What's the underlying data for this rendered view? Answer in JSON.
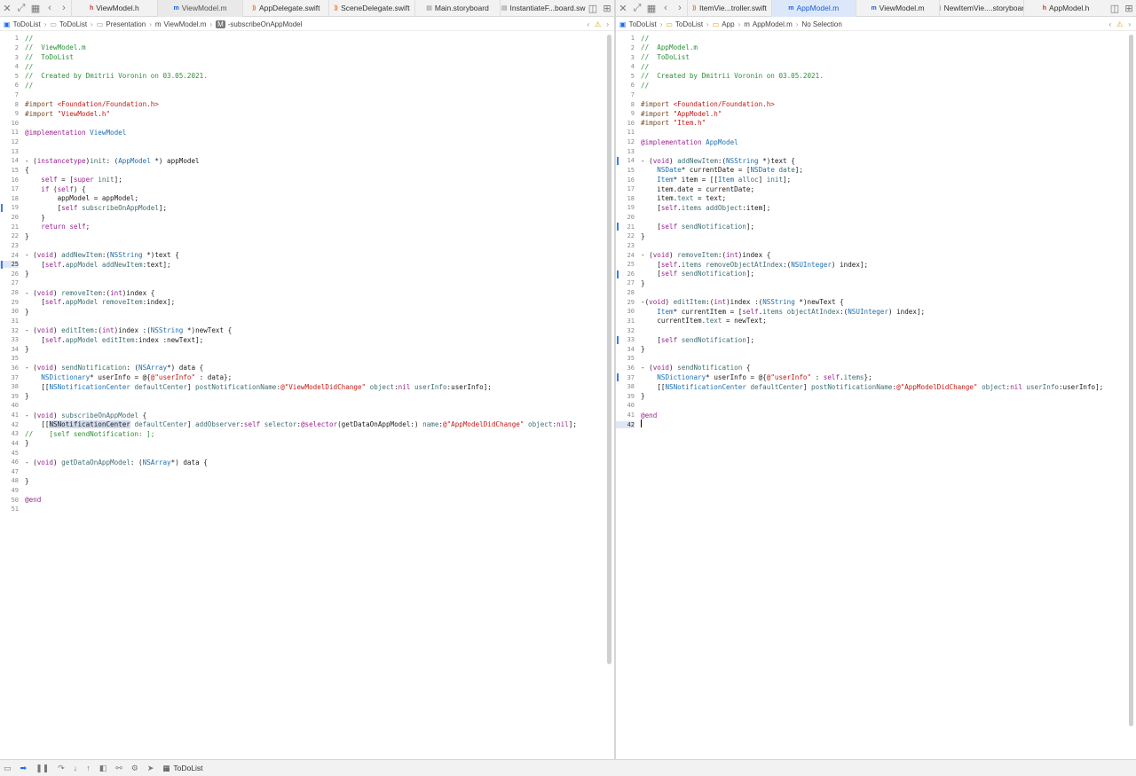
{
  "left": {
    "tabs": [
      {
        "icon": "h",
        "label": "ViewModel.h"
      },
      {
        "icon": "m",
        "label": "ViewModel.m"
      },
      {
        "icon": "swift",
        "label": "AppDelegate.swift"
      },
      {
        "icon": "swift",
        "label": "SceneDelegate.swift"
      },
      {
        "icon": "storyboard",
        "label": "Main.storyboard"
      },
      {
        "icon": "storyboard",
        "label": "InstantiateF...board.sw"
      }
    ],
    "breadcrumb": [
      "ToDoList",
      "ToDoList",
      "Presentation",
      "ViewModel.m",
      "-subscribeOnAppModel"
    ],
    "current_line": 25
  },
  "right": {
    "tabs": [
      {
        "icon": "swift",
        "label": "ItemVie...troller.swift"
      },
      {
        "icon": "m",
        "label": "AppModel.m"
      },
      {
        "icon": "m",
        "label": "ViewModel.m"
      },
      {
        "icon": "storyboard",
        "label": "NewItemVie....storyboard"
      },
      {
        "icon": "h",
        "label": "AppModel.h"
      }
    ],
    "breadcrumb": [
      "ToDoList",
      "ToDoList",
      "App",
      "AppModel.m",
      "No Selection"
    ],
    "current_line": 42
  },
  "bottom": {
    "scheme": "ToDoList"
  },
  "colors": {
    "accent": "#1b6cf2",
    "comment": "#2f8f3a",
    "keyword": "#9b2393",
    "string": "#c41a16",
    "type": "#1c6fb0"
  },
  "code_left": [
    [
      [
        "cm",
        "//"
      ]
    ],
    [
      [
        "cm",
        "//  ViewModel.m"
      ]
    ],
    [
      [
        "cm",
        "//  ToDoList"
      ]
    ],
    [
      [
        "cm",
        "//"
      ]
    ],
    [
      [
        "cm",
        "//  Created by Dmitrii Voronin on 03.05.2021."
      ]
    ],
    [
      [
        "cm",
        "//"
      ]
    ],
    [],
    [
      [
        "pp",
        "#import "
      ],
      [
        "st",
        "<Foundation/Foundation.h>"
      ]
    ],
    [
      [
        "pp",
        "#import "
      ],
      [
        "st",
        "\"ViewModel.h\""
      ]
    ],
    [],
    [
      [
        "kw",
        "@implementation "
      ],
      [
        "ty",
        "ViewModel"
      ]
    ],
    [],
    [],
    [
      [
        "",
        "- ("
      ],
      [
        "kw",
        "instancetype"
      ],
      [
        "",
        ")"
      ],
      [
        "mt",
        "init"
      ],
      [
        "",
        ": ("
      ],
      [
        "ty",
        "AppModel"
      ],
      [
        "",
        " *) appModel"
      ]
    ],
    [
      [
        "",
        "{"
      ]
    ],
    [
      [
        "",
        "    "
      ],
      [
        "kw",
        "self"
      ],
      [
        "",
        " = ["
      ],
      [
        "kw",
        "super"
      ],
      [
        "",
        " "
      ],
      [
        "mt",
        "init"
      ],
      [
        "",
        "];"
      ]
    ],
    [
      [
        "",
        "    "
      ],
      [
        "kw",
        "if"
      ],
      [
        "",
        " ("
      ],
      [
        "kw",
        "self"
      ],
      [
        "",
        ") {"
      ]
    ],
    [
      [
        "",
        "        appModel = appModel;"
      ]
    ],
    [
      [
        "",
        "        ["
      ],
      [
        "kw",
        "self"
      ],
      [
        "",
        " "
      ],
      [
        "mt",
        "subscribeOnAppModel"
      ],
      [
        "",
        "];"
      ]
    ],
    [
      [
        "",
        "    }"
      ]
    ],
    [
      [
        "",
        "    "
      ],
      [
        "kw",
        "return"
      ],
      [
        "",
        " "
      ],
      [
        "kw",
        "self"
      ],
      [
        "",
        ";"
      ]
    ],
    [
      [
        "",
        "}"
      ]
    ],
    [],
    [
      [
        "",
        "- ("
      ],
      [
        "kw",
        "void"
      ],
      [
        "",
        ") "
      ],
      [
        "mt",
        "addNewItem"
      ],
      [
        "",
        ":("
      ],
      [
        "ty",
        "NSString"
      ],
      [
        "",
        " *)text {"
      ]
    ],
    [
      [
        "",
        "    ["
      ],
      [
        "kw",
        "self"
      ],
      [
        "",
        "."
      ],
      [
        "mt",
        "appModel"
      ],
      [
        "",
        " "
      ],
      [
        "mt",
        "addNewItem"
      ],
      [
        "",
        ":text];"
      ]
    ],
    [
      [
        "",
        "}"
      ]
    ],
    [],
    [
      [
        "",
        "- ("
      ],
      [
        "kw",
        "void"
      ],
      [
        "",
        ") "
      ],
      [
        "mt",
        "removeItem"
      ],
      [
        "",
        ":("
      ],
      [
        "kw",
        "int"
      ],
      [
        "",
        ")index {"
      ]
    ],
    [
      [
        "",
        "    ["
      ],
      [
        "kw",
        "self"
      ],
      [
        "",
        "."
      ],
      [
        "mt",
        "appModel"
      ],
      [
        "",
        " "
      ],
      [
        "mt",
        "removeItem"
      ],
      [
        "",
        ":index];"
      ]
    ],
    [
      [
        "",
        "}"
      ]
    ],
    [],
    [
      [
        "",
        "- ("
      ],
      [
        "kw",
        "void"
      ],
      [
        "",
        ") "
      ],
      [
        "mt",
        "editItem"
      ],
      [
        "",
        ":("
      ],
      [
        "kw",
        "int"
      ],
      [
        "",
        ")index :("
      ],
      [
        "ty",
        "NSString"
      ],
      [
        "",
        " *)newText {"
      ]
    ],
    [
      [
        "",
        "    ["
      ],
      [
        "kw",
        "self"
      ],
      [
        "",
        "."
      ],
      [
        "mt",
        "appModel"
      ],
      [
        "",
        " "
      ],
      [
        "mt",
        "editItem"
      ],
      [
        "",
        ":index :newText];"
      ]
    ],
    [
      [
        "",
        "}"
      ]
    ],
    [],
    [
      [
        "",
        "- ("
      ],
      [
        "kw",
        "void"
      ],
      [
        "",
        ") "
      ],
      [
        "mt",
        "sendNotification"
      ],
      [
        "",
        ": ("
      ],
      [
        "ty",
        "NSArray"
      ],
      [
        "",
        "*) data {"
      ]
    ],
    [
      [
        "",
        "    "
      ],
      [
        "ty",
        "NSDictionary"
      ],
      [
        "",
        "* userInfo = @{"
      ],
      [
        "st",
        "@\"userInfo\""
      ],
      [
        "",
        " : data};"
      ]
    ],
    [
      [
        "",
        "    [["
      ],
      [
        "ty",
        "NSNotificationCenter"
      ],
      [
        "",
        " "
      ],
      [
        "mt",
        "defaultCenter"
      ],
      [
        "",
        "] "
      ],
      [
        "mt",
        "postNotificationName"
      ],
      [
        "",
        ":"
      ],
      [
        "st",
        "@\"ViewModelDidChange\""
      ],
      [
        "",
        " "
      ],
      [
        "mt",
        "object"
      ],
      [
        "",
        ":"
      ],
      [
        "kw",
        "nil"
      ],
      [
        "",
        " "
      ],
      [
        "mt",
        "userInfo"
      ],
      [
        "",
        ":userInfo];"
      ]
    ],
    [
      [
        "",
        "}"
      ]
    ],
    [],
    [
      [
        "",
        "- ("
      ],
      [
        "kw",
        "void"
      ],
      [
        "",
        ") "
      ],
      [
        "mt",
        "subscribeOnAppModel"
      ],
      [
        "",
        " {"
      ]
    ],
    [
      [
        "",
        "    [["
      ],
      [
        "hl",
        "NSNotificationCenter"
      ],
      [
        "",
        " "
      ],
      [
        "mt",
        "defaultCenter"
      ],
      [
        "",
        "] "
      ],
      [
        "mt",
        "addObserver"
      ],
      [
        "",
        ":"
      ],
      [
        "kw",
        "self"
      ],
      [
        "",
        " "
      ],
      [
        "mt",
        "selector"
      ],
      [
        "",
        ":"
      ],
      [
        "kw",
        "@selector"
      ],
      [
        "",
        "(getDataOnAppModel:) "
      ],
      [
        "mt",
        "name"
      ],
      [
        "",
        ":"
      ],
      [
        "st",
        "@\"AppModelDidChange\""
      ],
      [
        "",
        " "
      ],
      [
        "mt",
        "object"
      ],
      [
        "",
        ":"
      ],
      [
        "kw",
        "nil"
      ],
      [
        "",
        "];"
      ]
    ],
    [
      [
        "cm",
        "//    [self sendNotification: ];"
      ]
    ],
    [
      [
        "",
        "}"
      ]
    ],
    [],
    [
      [
        "",
        "- ("
      ],
      [
        "kw",
        "void"
      ],
      [
        "",
        ") "
      ],
      [
        "mt",
        "getDataOnAppModel"
      ],
      [
        "",
        ": ("
      ],
      [
        "ty",
        "NSArray"
      ],
      [
        "",
        "*) data {"
      ]
    ],
    [],
    [
      [
        "",
        "}"
      ]
    ],
    [],
    [
      [
        "kw",
        "@end"
      ]
    ],
    []
  ],
  "code_right": [
    [
      [
        "cm",
        "//"
      ]
    ],
    [
      [
        "cm",
        "//  AppModel.m"
      ]
    ],
    [
      [
        "cm",
        "//  ToDoList"
      ]
    ],
    [
      [
        "cm",
        "//"
      ]
    ],
    [
      [
        "cm",
        "//  Created by Dmitrii Voronin on 03.05.2021."
      ]
    ],
    [
      [
        "cm",
        "//"
      ]
    ],
    [],
    [
      [
        "pp",
        "#import "
      ],
      [
        "st",
        "<Foundation/Foundation.h>"
      ]
    ],
    [
      [
        "pp",
        "#import "
      ],
      [
        "st",
        "\"AppModel.h\""
      ]
    ],
    [
      [
        "pp",
        "#import "
      ],
      [
        "st",
        "\"Item.h\""
      ]
    ],
    [],
    [
      [
        "kw",
        "@implementation "
      ],
      [
        "ty",
        "AppModel"
      ]
    ],
    [],
    [
      [
        "",
        "- ("
      ],
      [
        "kw",
        "void"
      ],
      [
        "",
        ") "
      ],
      [
        "mt",
        "addNewItem"
      ],
      [
        "",
        ":("
      ],
      [
        "ty",
        "NSString"
      ],
      [
        "",
        " *)text {"
      ]
    ],
    [
      [
        "",
        "    "
      ],
      [
        "ty",
        "NSDate"
      ],
      [
        "",
        "* currentDate = ["
      ],
      [
        "ty",
        "NSDate"
      ],
      [
        "",
        " "
      ],
      [
        "mt",
        "date"
      ],
      [
        "",
        "];"
      ]
    ],
    [
      [
        "",
        "    "
      ],
      [
        "ty",
        "Item"
      ],
      [
        "",
        "* item = [["
      ],
      [
        "ty",
        "Item"
      ],
      [
        "",
        " "
      ],
      [
        "mt",
        "alloc"
      ],
      [
        "",
        "] "
      ],
      [
        "mt",
        "init"
      ],
      [
        "",
        "];"
      ]
    ],
    [
      [
        "",
        "    item.date = currentDate;"
      ]
    ],
    [
      [
        "",
        "    item."
      ],
      [
        "mt",
        "text"
      ],
      [
        "",
        " = text;"
      ]
    ],
    [
      [
        "",
        "    ["
      ],
      [
        "kw",
        "self"
      ],
      [
        "",
        "."
      ],
      [
        "mt",
        "items"
      ],
      [
        "",
        " "
      ],
      [
        "mt",
        "addObject"
      ],
      [
        "",
        ":item];"
      ]
    ],
    [],
    [
      [
        "",
        "    ["
      ],
      [
        "kw",
        "self"
      ],
      [
        "",
        " "
      ],
      [
        "mt",
        "sendNotification"
      ],
      [
        "",
        "];"
      ]
    ],
    [
      [
        "",
        "}"
      ]
    ],
    [],
    [
      [
        "",
        "- ("
      ],
      [
        "kw",
        "void"
      ],
      [
        "",
        ") "
      ],
      [
        "mt",
        "removeItem"
      ],
      [
        "",
        ":("
      ],
      [
        "kw",
        "int"
      ],
      [
        "",
        ")index {"
      ]
    ],
    [
      [
        "",
        "    ["
      ],
      [
        "kw",
        "self"
      ],
      [
        "",
        "."
      ],
      [
        "mt",
        "items"
      ],
      [
        "",
        " "
      ],
      [
        "mt",
        "removeObjectAtIndex"
      ],
      [
        "",
        ":("
      ],
      [
        "ty",
        "NSUInteger"
      ],
      [
        "",
        ") index];"
      ]
    ],
    [
      [
        "",
        "    ["
      ],
      [
        "kw",
        "self"
      ],
      [
        "",
        " "
      ],
      [
        "mt",
        "sendNotification"
      ],
      [
        "",
        "];"
      ]
    ],
    [
      [
        "",
        "}"
      ]
    ],
    [],
    [
      [
        "",
        "-("
      ],
      [
        "kw",
        "void"
      ],
      [
        "",
        ") "
      ],
      [
        "mt",
        "editItem"
      ],
      [
        "",
        ":("
      ],
      [
        "kw",
        "int"
      ],
      [
        "",
        ")index :("
      ],
      [
        "ty",
        "NSString"
      ],
      [
        "",
        " *)newText {"
      ]
    ],
    [
      [
        "",
        "    "
      ],
      [
        "ty",
        "Item"
      ],
      [
        "",
        "* currentItem = ["
      ],
      [
        "kw",
        "self"
      ],
      [
        "",
        "."
      ],
      [
        "mt",
        "items"
      ],
      [
        "",
        " "
      ],
      [
        "mt",
        "objectAtIndex"
      ],
      [
        "",
        ":("
      ],
      [
        "ty",
        "NSUInteger"
      ],
      [
        "",
        ") index];"
      ]
    ],
    [
      [
        "",
        "    currentItem."
      ],
      [
        "mt",
        "text"
      ],
      [
        "",
        " = newText;"
      ]
    ],
    [],
    [
      [
        "",
        "    ["
      ],
      [
        "kw",
        "self"
      ],
      [
        "",
        " "
      ],
      [
        "mt",
        "sendNotification"
      ],
      [
        "",
        "];"
      ]
    ],
    [
      [
        "",
        "}"
      ]
    ],
    [],
    [
      [
        "",
        "- ("
      ],
      [
        "kw",
        "void"
      ],
      [
        "",
        ") "
      ],
      [
        "mt",
        "sendNotification"
      ],
      [
        "",
        " {"
      ]
    ],
    [
      [
        "",
        "    "
      ],
      [
        "ty",
        "NSDictionary"
      ],
      [
        "",
        "* userInfo = @{"
      ],
      [
        "st",
        "@\"userInfo\""
      ],
      [
        "",
        " : "
      ],
      [
        "kw",
        "self"
      ],
      [
        "",
        "."
      ],
      [
        "mt",
        "items"
      ],
      [
        "",
        "};"
      ]
    ],
    [
      [
        "",
        "    [["
      ],
      [
        "ty",
        "NSNotificationCenter"
      ],
      [
        "",
        " "
      ],
      [
        "mt",
        "defaultCenter"
      ],
      [
        "",
        "] "
      ],
      [
        "mt",
        "postNotificationName"
      ],
      [
        "",
        ":"
      ],
      [
        "st",
        "@\"AppModelDidChange\""
      ],
      [
        "",
        " "
      ],
      [
        "mt",
        "object"
      ],
      [
        "",
        ":"
      ],
      [
        "kw",
        "nil"
      ],
      [
        "",
        " "
      ],
      [
        "mt",
        "userInfo"
      ],
      [
        "",
        ":userInfo];"
      ]
    ],
    [
      [
        "",
        "}"
      ]
    ],
    [],
    [
      [
        "kw",
        "@end"
      ]
    ],
    []
  ]
}
